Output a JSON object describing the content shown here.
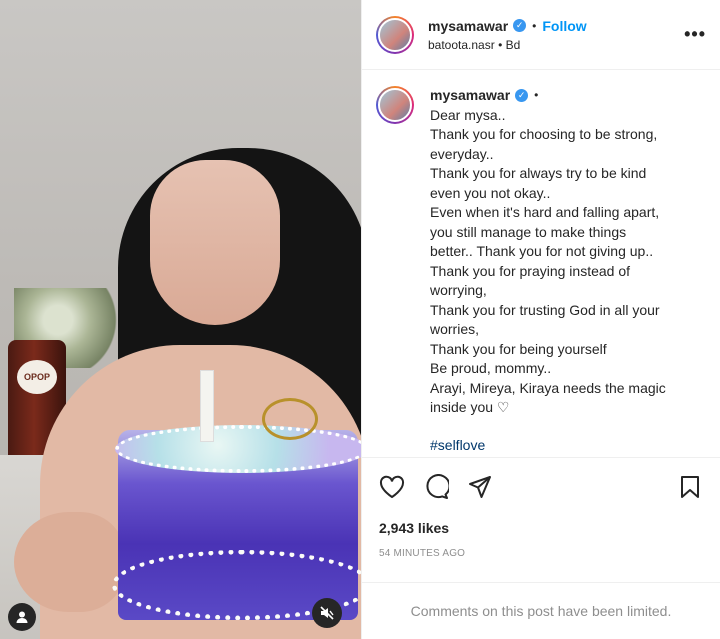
{
  "post": {
    "username": "mysamawar",
    "follow_label": "Follow",
    "location": "batoota.nasr",
    "time_short": "Bd",
    "more_label": "•••"
  },
  "media": {
    "bottle_label": "OPOP"
  },
  "caption": {
    "username": "mysamawar",
    "lines": [
      "Dear mysa..",
      "Thank you for choosing to be strong,",
      "everyday..",
      "Thank you for always try to be kind",
      "even you not okay..",
      "Even when it's hard and falling apart,",
      "you still manage to make things",
      "better.. Thank you for not giving up..",
      "Thank you for praying instead of",
      "worrying,",
      "Thank you for trusting God in all your",
      "worries,",
      "Thank you for being yourself",
      "Be proud, mommy..",
      "Arayi, Mireya, Kiraya needs the magic",
      "inside you ♡"
    ],
    "hashtag": "#selflove"
  },
  "stats": {
    "likes": "2,943 likes",
    "time_ago": "54 MINUTES AGO"
  },
  "comments": {
    "limited_text": "Comments on this post have been limited."
  },
  "icons": {
    "like": "heart-icon",
    "comment": "comment-icon",
    "share": "share-icon",
    "save": "bookmark-icon",
    "tags": "user-tag-icon",
    "mute": "mute-icon",
    "verified": "verified-badge-icon"
  },
  "colors": {
    "accent": "#0095f6",
    "verified": "#3897f0",
    "muted_text": "#8e8e8e",
    "hashtag": "#00376b"
  }
}
